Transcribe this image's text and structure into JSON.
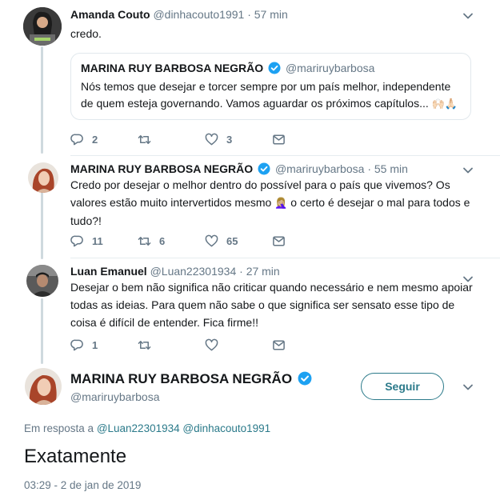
{
  "tweets": [
    {
      "name": "Amanda Couto",
      "handle": "@dinhacouto1991",
      "dot": "·",
      "time": "57 min",
      "text": "credo.",
      "quote": {
        "name": "MARINA RUY BARBOSA NEGRÃO",
        "handle": "@mariruybarbosa",
        "text": "Nós temos que desejar e torcer sempre por um país melhor, independente de quem esteja governando. Vamos aguardar os próximos capítulos...",
        "emoji": "🙌🏻🙏🏻"
      },
      "replies": "2",
      "retweets": "",
      "likes": "3"
    },
    {
      "name": "MARINA RUY BARBOSA NEGRÃO",
      "handle": "@mariruybarbosa",
      "dot": "·",
      "time": "55 min",
      "text_a": "Credo por desejar o melhor dentro do possível para o país que vivemos? Os valores estão muito intervertidos mesmo",
      "emoji": "🤦🏼‍♀️",
      "text_b": "o certo é desejar o mal para todos e tudo?!",
      "replies": "11",
      "retweets": "6",
      "likes": "65"
    },
    {
      "name": "Luan Emanuel",
      "handle": "@Luan22301934",
      "dot": "·",
      "time": "27 min",
      "text": "Desejar o bem não significa não criticar quando necessário e nem mesmo apoiar todas as ideias. Para quem não sabe o que significa ser sensato esse tipo de coisa é difícil de entender. Fica firme!!",
      "replies": "1",
      "retweets": "",
      "likes": ""
    }
  ],
  "main": {
    "name": "MARINA RUY BARBOSA NEGRÃO",
    "handle": "@mariruybarbosa",
    "follow_label": "Seguir",
    "reply_prefix": "Em resposta a",
    "reply_user1": "@Luan22301934",
    "reply_user2": "@dinhacouto1991",
    "text": "Exatamente",
    "timestamp": "03:29 - 2 de jan de 2019"
  },
  "colors": {
    "accent": "#2b7a8a",
    "verified": "#1da1f2",
    "secondary_text": "#657786",
    "thread_line": "#cfd9de"
  }
}
